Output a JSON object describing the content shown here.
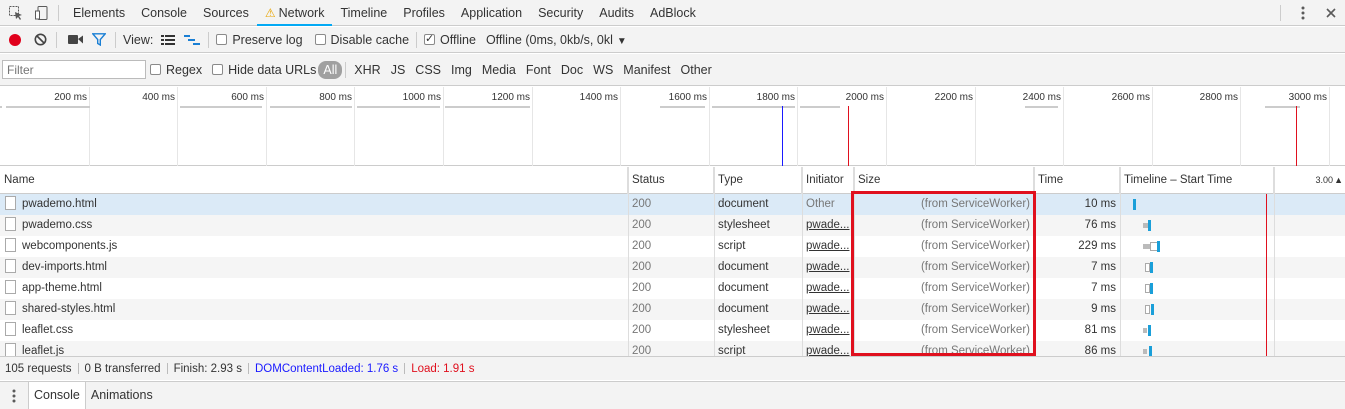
{
  "tabs": [
    "Elements",
    "Console",
    "Sources",
    "Network",
    "Timeline",
    "Profiles",
    "Application",
    "Security",
    "Audits",
    "AdBlock"
  ],
  "active_tab": "Network",
  "toolbar": {
    "view_label": "View:",
    "preserve_log": "Preserve log",
    "disable_cache": "Disable cache",
    "offline": "Offline",
    "throttle": "Offline (0ms, 0kb/s, 0kl"
  },
  "filter": {
    "placeholder": "Filter",
    "regex": "Regex",
    "hide_data_urls": "Hide data URLs",
    "types": [
      "All",
      "XHR",
      "JS",
      "CSS",
      "Img",
      "Media",
      "Font",
      "Doc",
      "WS",
      "Manifest",
      "Other"
    ]
  },
  "overview": {
    "ticks": [
      "200 ms",
      "400 ms",
      "600 ms",
      "800 ms",
      "1000 ms",
      "1200 ms",
      "1400 ms",
      "1600 ms",
      "1800 ms",
      "2000 ms",
      "2200 ms",
      "2400 ms",
      "2600 ms",
      "2800 ms",
      "3000 ms"
    ]
  },
  "columns": {
    "name": "Name",
    "status": "Status",
    "type": "Type",
    "initiator": "Initiator",
    "size": "Size",
    "time": "Time",
    "timeline": "Timeline – Start Time",
    "scale": "3.00"
  },
  "rows": [
    {
      "name": "pwademo.html",
      "status": "200",
      "type": "document",
      "initiator": "Other",
      "size": "(from ServiceWorker)",
      "time": "10 ms"
    },
    {
      "name": "pwademo.css",
      "status": "200",
      "type": "stylesheet",
      "initiator": "pwade...",
      "size": "(from ServiceWorker)",
      "time": "76 ms"
    },
    {
      "name": "webcomponents.js",
      "status": "200",
      "type": "script",
      "initiator": "pwade...",
      "size": "(from ServiceWorker)",
      "time": "229 ms"
    },
    {
      "name": "dev-imports.html",
      "status": "200",
      "type": "document",
      "initiator": "pwade...",
      "size": "(from ServiceWorker)",
      "time": "7 ms"
    },
    {
      "name": "app-theme.html",
      "status": "200",
      "type": "document",
      "initiator": "pwade...",
      "size": "(from ServiceWorker)",
      "time": "7 ms"
    },
    {
      "name": "shared-styles.html",
      "status": "200",
      "type": "document",
      "initiator": "pwade...",
      "size": "(from ServiceWorker)",
      "time": "9 ms"
    },
    {
      "name": "leaflet.css",
      "status": "200",
      "type": "stylesheet",
      "initiator": "pwade...",
      "size": "(from ServiceWorker)",
      "time": "81 ms"
    },
    {
      "name": "leaflet.js",
      "status": "200",
      "type": "script",
      "initiator": "pwade...",
      "size": "(from ServiceWorker)",
      "time": "86 ms"
    }
  ],
  "status": {
    "requests": "105 requests",
    "transferred": "0 B transferred",
    "finish": "Finish: 2.93 s",
    "dcl": "DOMContentLoaded: 1.76 s",
    "load": "Load: 1.91 s"
  },
  "drawer": {
    "tabs": [
      "Console",
      "Animations"
    ]
  },
  "colors": {
    "accent": "#03a9f4",
    "dcl": "#1a1aff",
    "load": "#e0101e",
    "record": "#e0001b"
  }
}
